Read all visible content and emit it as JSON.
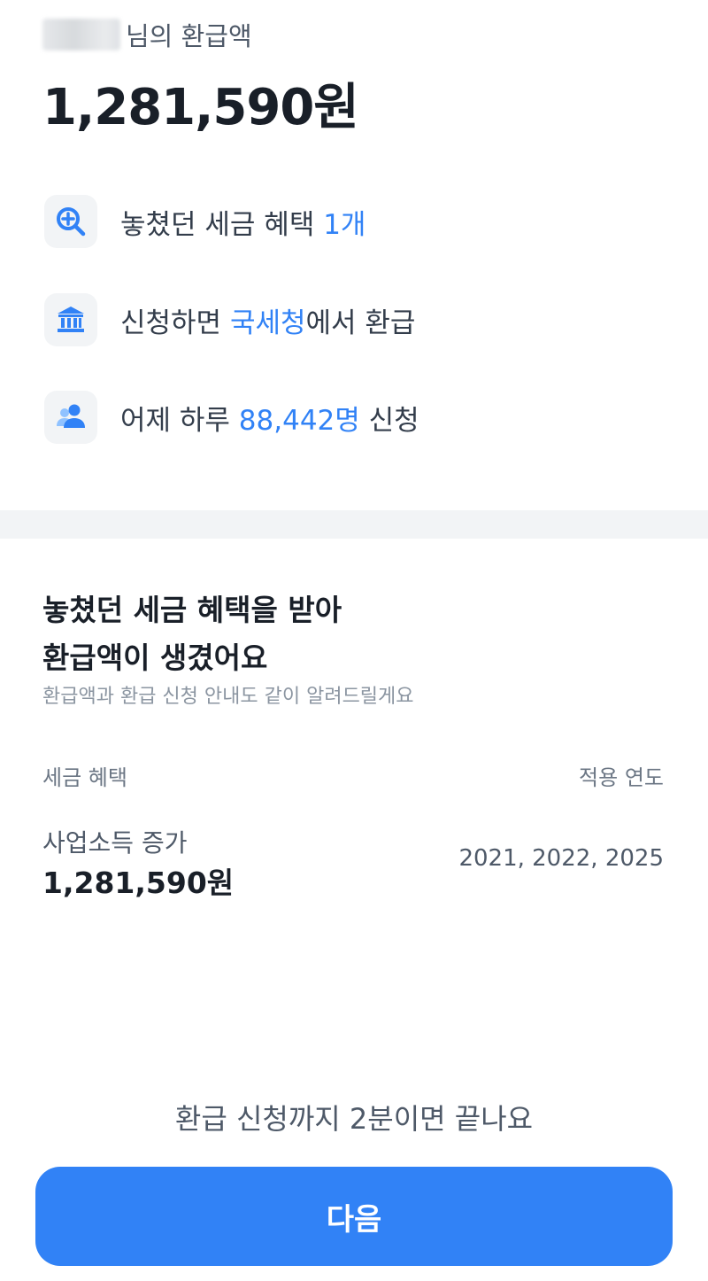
{
  "header": {
    "greeting_suffix": "님의 환급액",
    "refund_amount": "1,281,590원"
  },
  "features": [
    {
      "icon": "magnifier-plus-icon",
      "text_before": "놓쳤던 세금 혜택 ",
      "highlight": "1개",
      "text_after": ""
    },
    {
      "icon": "bank-building-icon",
      "text_before": "신청하면 ",
      "highlight": "국세청",
      "text_after": "에서 환급"
    },
    {
      "icon": "users-icon",
      "text_before": "어제 하루 ",
      "highlight": "88,442명",
      "text_after": " 신청"
    }
  ],
  "section": {
    "title_line1": "놓쳤던 세금 혜택을 받아",
    "title_line2": "환급액이 생겼어요",
    "subtitle": "환급액과 환급 신청 안내도 같이 알려드릴게요",
    "col_benefit": "세금 혜택",
    "col_year": "적용 연도",
    "rows": [
      {
        "name": "사업소득 증가",
        "amount": "1,281,590원",
        "years": "2021, 2022, 2025"
      }
    ]
  },
  "footer": {
    "note": "환급 신청까지 2분이면 끝나요",
    "next_label": "다음"
  },
  "colors": {
    "accent": "#3182f6",
    "divider": "#f2f4f6",
    "icon_bg": "#f2f4f6"
  }
}
